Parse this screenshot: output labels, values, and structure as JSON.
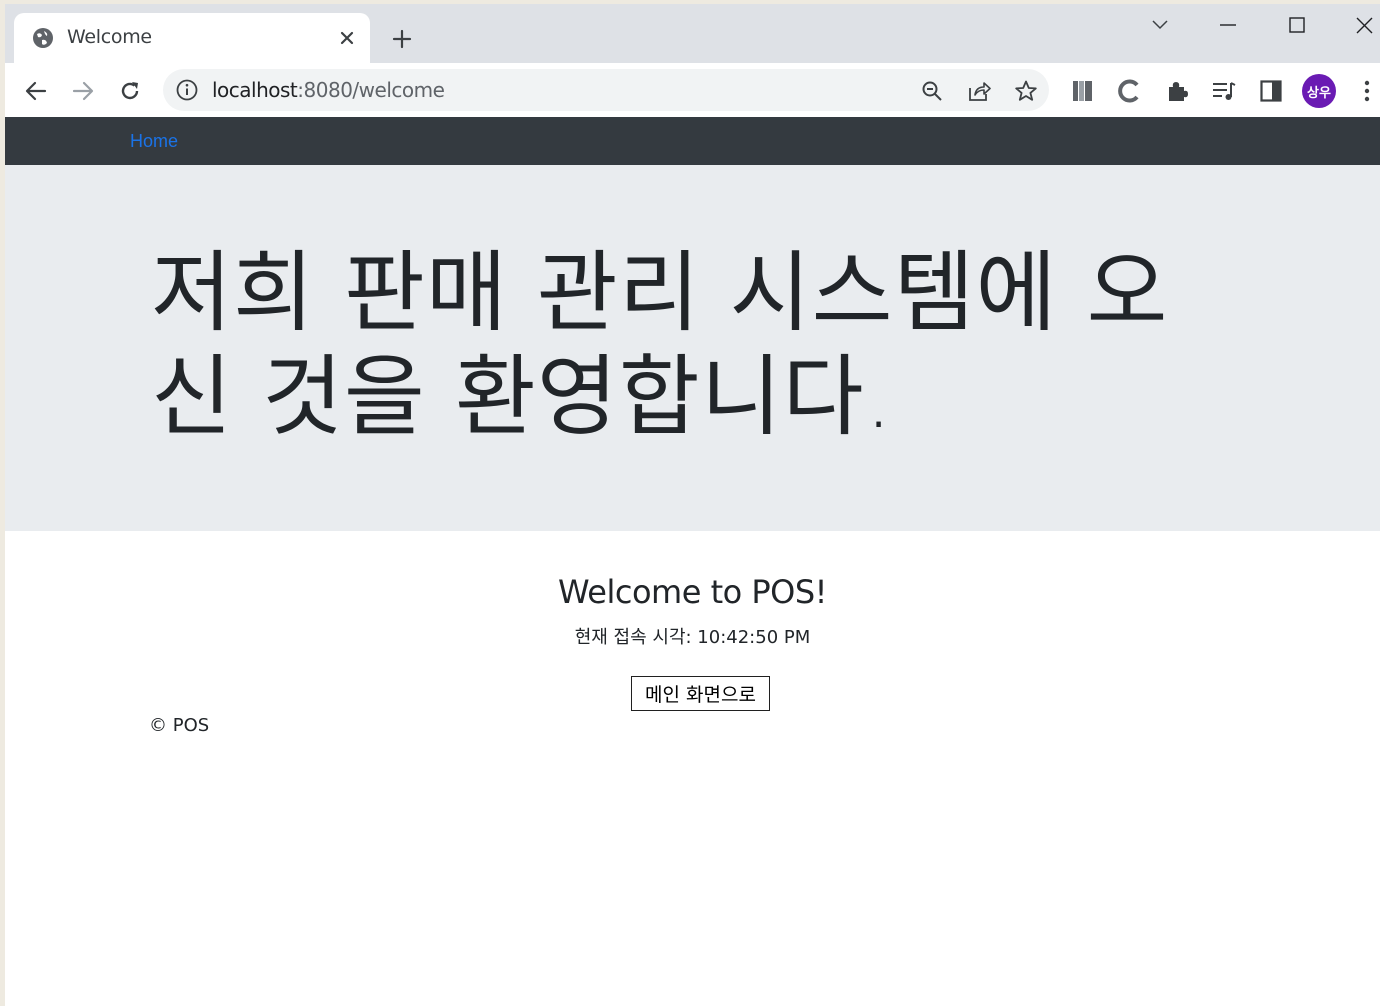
{
  "browser": {
    "tab_title": "Welcome",
    "url_host": "localhost",
    "url_path": ":8080/welcome",
    "profile_initials": "상우",
    "profile_color": "#6a1bb3",
    "icons": {
      "favicon": "globe-icon",
      "tab_close": "close-icon",
      "new_tab": "plus-icon",
      "tab_search": "chevron-down-icon",
      "minimize": "minimize-icon",
      "maximize": "maximize-icon",
      "close_window": "close-icon",
      "back": "arrow-left-icon",
      "forward": "arrow-right-icon",
      "reload": "reload-icon",
      "site_info": "info-icon",
      "zoom": "zoom-out-icon",
      "share": "share-icon",
      "bookmark": "star-icon",
      "extensions": [
        "books-icon",
        "c-icon",
        "puzzle-icon",
        "playlist-icon",
        "sidepanel-icon"
      ],
      "menu": "more-vertical-icon"
    }
  },
  "page": {
    "nav": {
      "home": "Home"
    },
    "jumbotron": {
      "line1": "저희 판매 관리 시스템에 오",
      "line2": "신 것을 환영합니다."
    },
    "heading": "Welcome to POS!",
    "time_text": "현재 접속 시각: 10:42:50 PM",
    "main_button": "메인 화면으로",
    "footer": "© POS",
    "colors": {
      "navbar": "#343a40",
      "jumbotron": "#e9ecef",
      "link": "#1a73e8"
    }
  }
}
